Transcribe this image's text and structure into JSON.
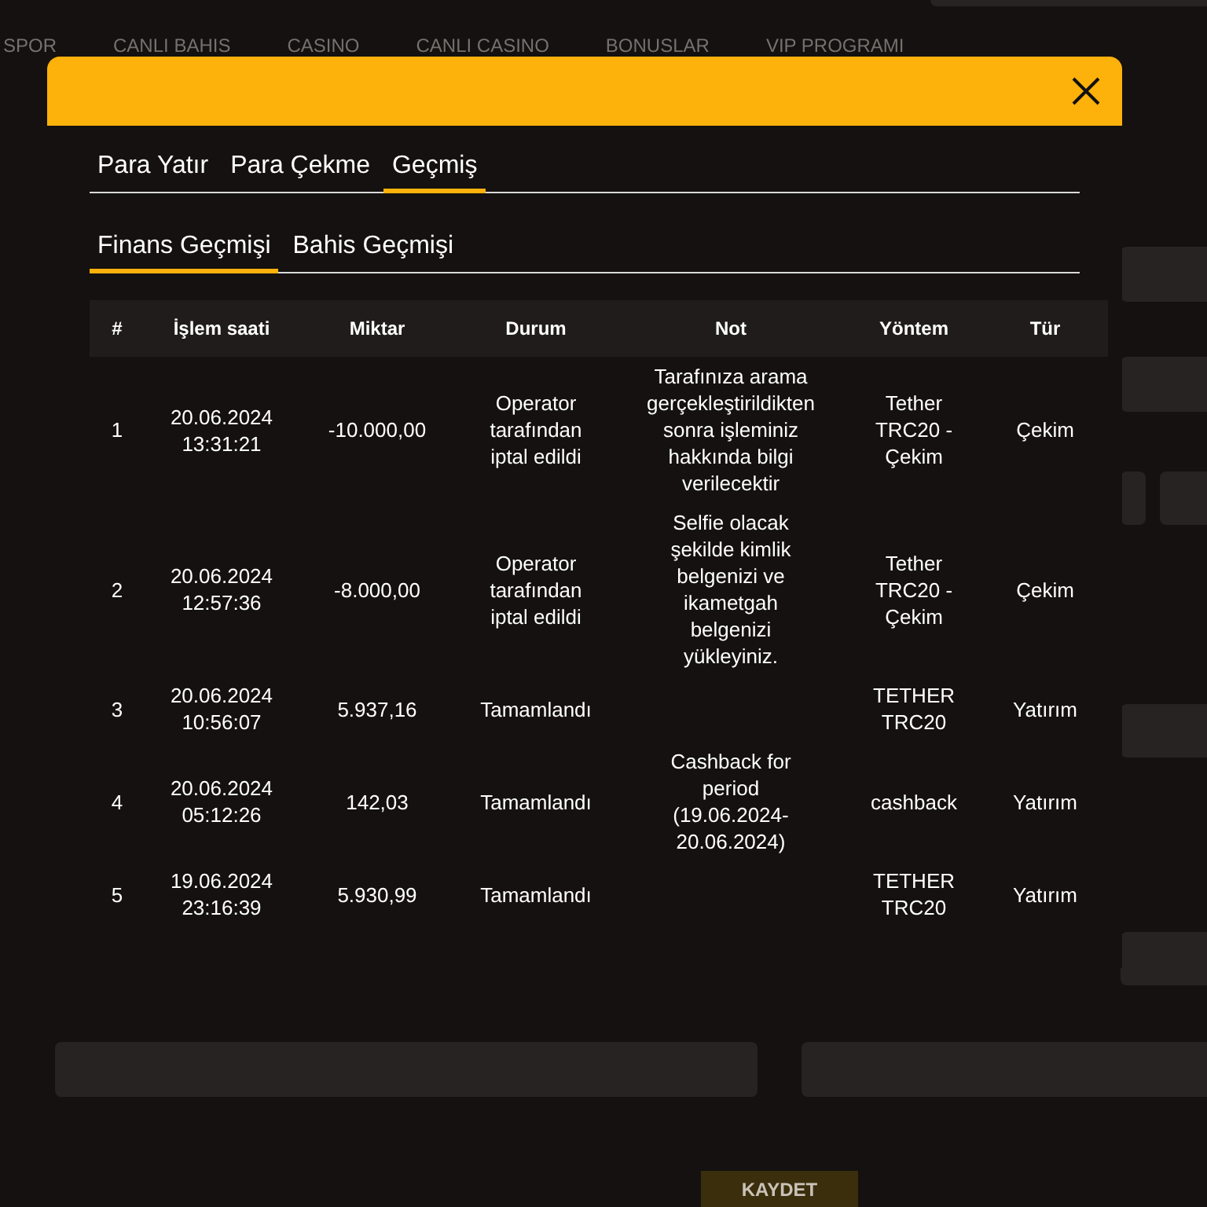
{
  "nav": [
    "SPOR",
    "CANLI BAHIS",
    "CASINO",
    "CANLI CASINO",
    "BONUSLAR",
    "VIP PROGRAMI"
  ],
  "background_button": "KAYDET",
  "modal": {
    "tabs": [
      {
        "label": "Para Yatır",
        "selected": false
      },
      {
        "label": "Para Çekme",
        "selected": false
      },
      {
        "label": "Geçmiş",
        "selected": true
      }
    ],
    "subtabs": [
      {
        "label": "Finans Geçmişi",
        "selected": true
      },
      {
        "label": "Bahis Geçmişi",
        "selected": false
      }
    ],
    "table": {
      "columns": [
        "#",
        "İşlem saati",
        "Miktar",
        "Durum",
        "Not",
        "Yöntem",
        "Tür"
      ],
      "rows": [
        {
          "no": "1",
          "time": "20.06.2024 13:31:21",
          "amount": "-10.000,00",
          "status": "Operator tarafından iptal edildi",
          "note": "Tarafınıza arama gerçekleştirildikten sonra işleminiz hakkında bilgi verilecektir",
          "method": "Tether TRC20 - Çekim",
          "type": "Çekim"
        },
        {
          "no": "2",
          "time": "20.06.2024 12:57:36",
          "amount": "-8.000,00",
          "status": "Operator tarafından iptal edildi",
          "note": "Selfie olacak şekilde kimlik belgenizi ve ikametgah belgenizi yükleyiniz.",
          "method": "Tether TRC20 - Çekim",
          "type": "Çekim"
        },
        {
          "no": "3",
          "time": "20.06.2024 10:56:07",
          "amount": "5.937,16",
          "status": "Tamamlandı",
          "method": "TETHER TRC20",
          "type": "Yatırım"
        },
        {
          "no": "4",
          "time": "20.06.2024 05:12:26",
          "amount": "142,03",
          "status": "Tamamlandı",
          "note": "Cashback for period (19.06.2024-20.06.2024)",
          "method": "cashback",
          "type": "Yatırım"
        },
        {
          "no": "5",
          "time": "19.06.2024 23:16:39",
          "amount": "5.930,99",
          "status": "Tamamlandı",
          "method": "TETHER TRC20",
          "type": "Yatırım"
        }
      ]
    }
  }
}
